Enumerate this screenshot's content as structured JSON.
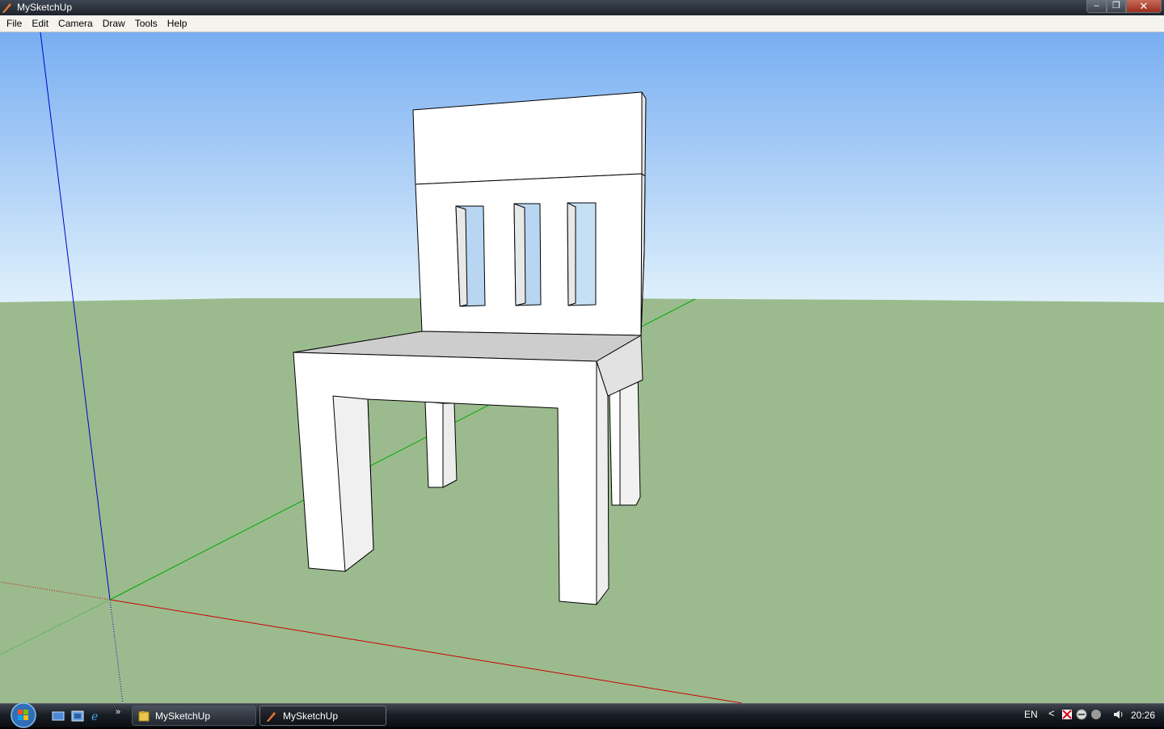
{
  "window": {
    "title": "MySketchUp",
    "controls": {
      "minimize": "–",
      "maximize": "❐",
      "close": "✕"
    }
  },
  "menu": {
    "items": [
      "File",
      "Edit",
      "Camera",
      "Draw",
      "Tools",
      "Help"
    ]
  },
  "scene": {
    "sky_top_color": "#78aef2",
    "sky_bottom_color": "#dff0fb",
    "ground_color": "#9bbb8e",
    "axis_colors": {
      "red": "#cc0000",
      "green": "#00aa00",
      "blue": "#0000cc"
    },
    "model": "chair"
  },
  "taskbar": {
    "quick_launch_more": "»",
    "tasks": [
      {
        "label": "MySketchUp",
        "icon": "folder-icon",
        "active": false
      },
      {
        "label": "MySketchUp",
        "icon": "sketchup-icon",
        "active": true
      }
    ],
    "tray": {
      "language": "EN",
      "show_hidden": "<",
      "clock": "20:26"
    }
  }
}
